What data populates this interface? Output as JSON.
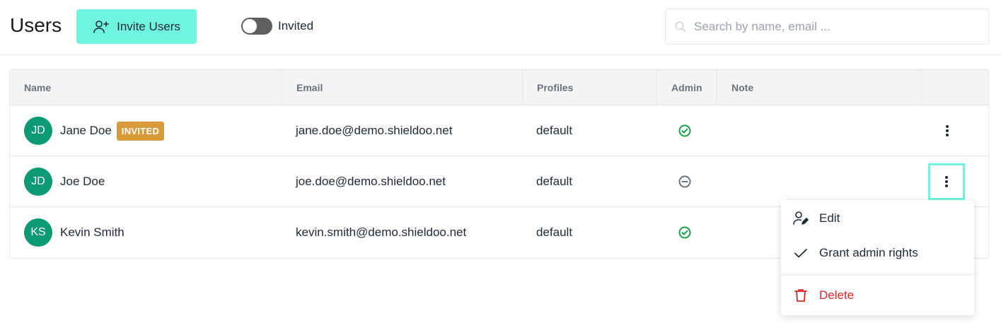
{
  "header": {
    "title": "Users",
    "invite_label": "Invite Users",
    "toggle_label": "Invited",
    "toggle_on": false,
    "search_placeholder": "Search by name, email ...",
    "search_value": ""
  },
  "table": {
    "columns": [
      "Name",
      "Email",
      "Profiles",
      "Admin",
      "Note",
      ""
    ],
    "rows": [
      {
        "initials": "JD",
        "name": "Jane Doe",
        "badge": "INVITED",
        "email": "jane.doe@demo.shieldoo.net",
        "profile": "default",
        "admin": "yes",
        "note": ""
      },
      {
        "initials": "JD",
        "name": "Joe Doe",
        "badge": "",
        "email": "joe.doe@demo.shieldoo.net",
        "profile": "default",
        "admin": "no",
        "note": ""
      },
      {
        "initials": "KS",
        "name": "Kevin Smith",
        "badge": "",
        "email": "kevin.smith@demo.shieldoo.net",
        "profile": "default",
        "admin": "yes",
        "note": ""
      }
    ]
  },
  "menu": {
    "edit": "Edit",
    "grant": "Grant admin rights",
    "delete": "Delete"
  },
  "colors": {
    "accent": "#6ff5df",
    "avatar": "#0b9a74",
    "badge": "#d99a39",
    "admin_yes": "#16a34a",
    "admin_no": "#6b7280",
    "danger": "#dc2626"
  }
}
